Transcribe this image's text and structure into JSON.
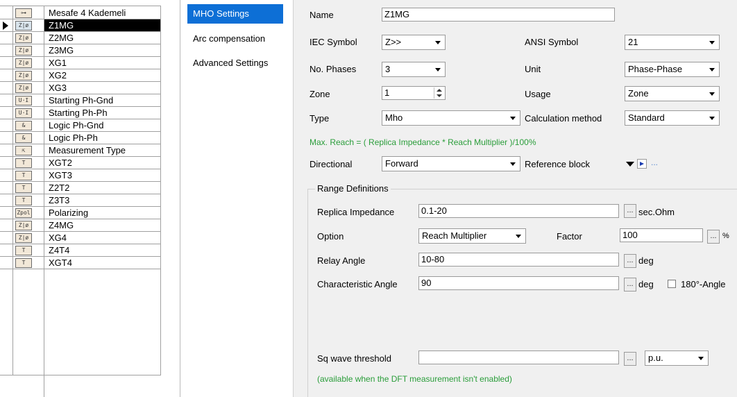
{
  "blocks": [
    {
      "icon": "⊶",
      "label": "Mesafe 4 Kademeli",
      "icon_name": "distance-group-icon"
    },
    {
      "icon": "Z|ø",
      "label": "Z1MG",
      "icon_name": "mho-zone-icon",
      "selected": true
    },
    {
      "icon": "Z|ø",
      "label": "Z2MG",
      "icon_name": "mho-zone-icon"
    },
    {
      "icon": "Z|ø",
      "label": "Z3MG",
      "icon_name": "mho-zone-icon"
    },
    {
      "icon": "Z|ø",
      "label": "XG1",
      "icon_name": "mho-zone-icon"
    },
    {
      "icon": "Z|ø",
      "label": "XG2",
      "icon_name": "mho-zone-icon"
    },
    {
      "icon": "Z|ø",
      "label": "XG3",
      "icon_name": "mho-zone-icon"
    },
    {
      "icon": "U·I",
      "label": "Starting Ph-Gnd",
      "icon_name": "starting-icon"
    },
    {
      "icon": "U·I",
      "label": "Starting Ph-Ph",
      "icon_name": "starting-icon"
    },
    {
      "icon": "&",
      "label": "Logic Ph-Gnd",
      "icon_name": "logic-icon"
    },
    {
      "icon": "&",
      "label": "Logic Ph-Ph",
      "icon_name": "logic-icon"
    },
    {
      "icon": "⇱",
      "label": "Measurement Type",
      "icon_name": "measurement-icon"
    },
    {
      "icon": "T",
      "label": "XGT2",
      "icon_name": "timer-icon"
    },
    {
      "icon": "T",
      "label": "XGT3",
      "icon_name": "timer-icon"
    },
    {
      "icon": "T",
      "label": "Z2T2",
      "icon_name": "timer-icon"
    },
    {
      "icon": "T",
      "label": "Z3T3",
      "icon_name": "timer-icon"
    },
    {
      "icon": "Zpol",
      "label": "Polarizing",
      "icon_name": "polarizing-icon"
    },
    {
      "icon": "Z|ø",
      "label": "Z4MG",
      "icon_name": "mho-zone-icon"
    },
    {
      "icon": "Z|ø",
      "label": "XG4",
      "icon_name": "mho-zone-icon"
    },
    {
      "icon": "T",
      "label": "Z4T4",
      "icon_name": "timer-icon"
    },
    {
      "icon": "T",
      "label": "XGT4",
      "icon_name": "timer-icon"
    }
  ],
  "nav": {
    "items": [
      "MHO Settings",
      "Arc compensation",
      "Advanced Settings"
    ],
    "active": "MHO Settings"
  },
  "form": {
    "name_label": "Name",
    "name_value": "Z1MG",
    "iec_label": "IEC Symbol",
    "iec_value": "Z>>",
    "ansi_label": "ANSI Symbol",
    "ansi_value": "21",
    "phases_label": "No. Phases",
    "phases_value": "3",
    "unit_label": "Unit",
    "unit_value": "Phase-Phase",
    "zone_label": "Zone",
    "zone_value": "1",
    "usage_label": "Usage",
    "usage_value": "Zone",
    "type_label": "Type",
    "type_value": "Mho",
    "calc_label": "Calculation method",
    "calc_value": "Standard",
    "formula": "Max. Reach = ( Replica Impedance * Reach Multiplier )/100%",
    "directional_label": "Directional",
    "directional_value": "Forward",
    "refblock_label": "Reference block",
    "refblock_ellipsis": "...",
    "range_title": "Range Definitions",
    "replica_label": "Replica Impedance",
    "replica_value": "0.1-20",
    "replica_unit": "sec.Ohm",
    "option_label": "Option",
    "option_value": "Reach Multiplier",
    "factor_label": "Factor",
    "factor_value": "100",
    "factor_unit": "%",
    "relay_label": "Relay Angle",
    "relay_value": "10-80",
    "relay_unit": "deg",
    "char_label": "Characteristic Angle",
    "char_value": "90",
    "char_unit": "deg",
    "angle180_label": "180°-Angle",
    "sq_label": "Sq wave threshold",
    "sq_value": "",
    "sq_unit": "p.u.",
    "note": "(available when the DFT measurement isn't enabled)",
    "dots": "..."
  }
}
